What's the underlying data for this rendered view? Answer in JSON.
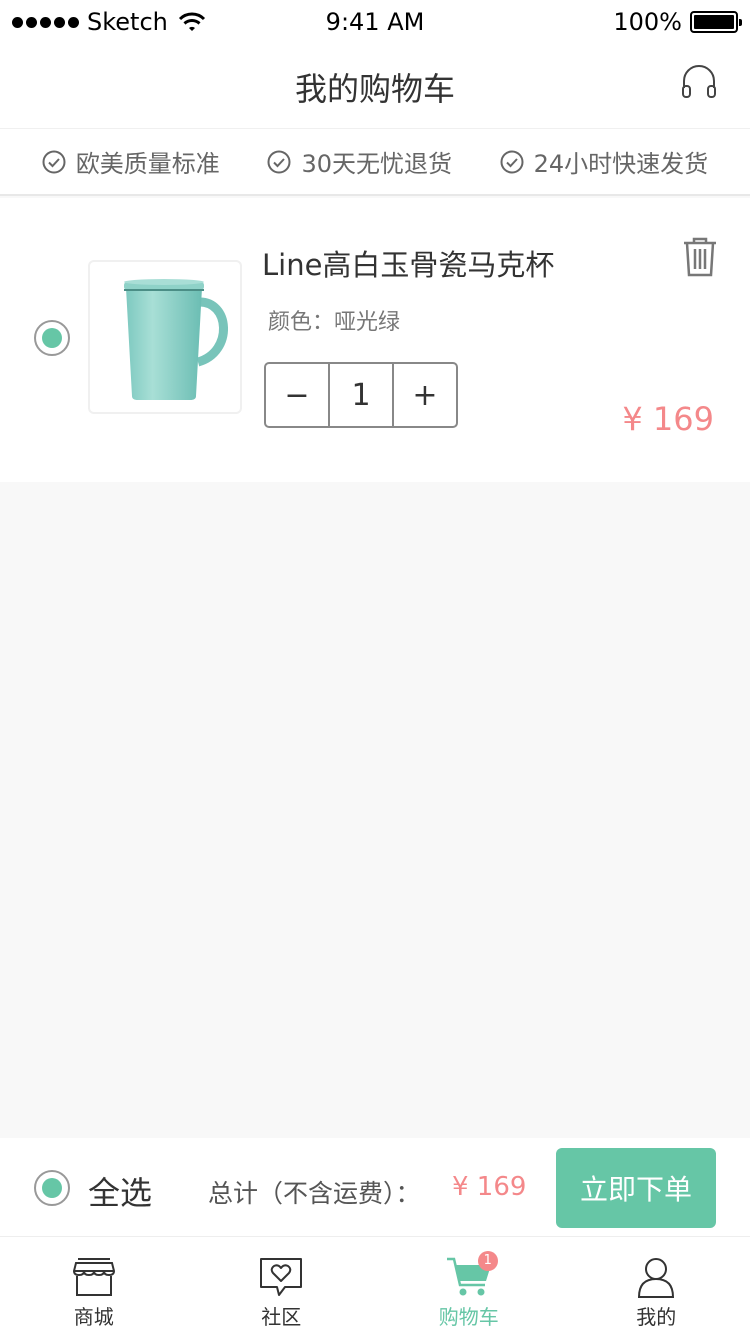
{
  "status_bar": {
    "carrier": "Sketch",
    "time": "9:41 AM",
    "battery": "100%"
  },
  "nav": {
    "title": "我的购物车",
    "support_icon": "headset-icon"
  },
  "guarantees": [
    {
      "label": "欧美质量标准",
      "icon": "check-circle-icon"
    },
    {
      "label": "30天无忧退货",
      "icon": "check-circle-icon"
    },
    {
      "label": "24小时快速发货",
      "icon": "check-circle-icon"
    }
  ],
  "cart_item": {
    "name": "Line高白玉骨瓷马克杯",
    "variant": "颜色：哑光绿",
    "quantity": "1",
    "decrement": "−",
    "increment": "+",
    "price": "¥ 169",
    "selected": true
  },
  "checkout": {
    "select_all": "全选",
    "total_label": "总计（不含运费）：",
    "total_value": "¥  169",
    "order_button": "立即下单"
  },
  "tabs": [
    {
      "label": "商城",
      "icon": "store-icon",
      "active": false
    },
    {
      "label": "社区",
      "icon": "community-heart-icon",
      "active": false
    },
    {
      "label": "购物车",
      "icon": "cart-icon",
      "active": true,
      "badge": "1"
    },
    {
      "label": "我的",
      "icon": "profile-icon",
      "active": false
    }
  ],
  "colors": {
    "accent": "#66c6a6",
    "price": "#f4888a",
    "background": "#f8f8f8"
  }
}
